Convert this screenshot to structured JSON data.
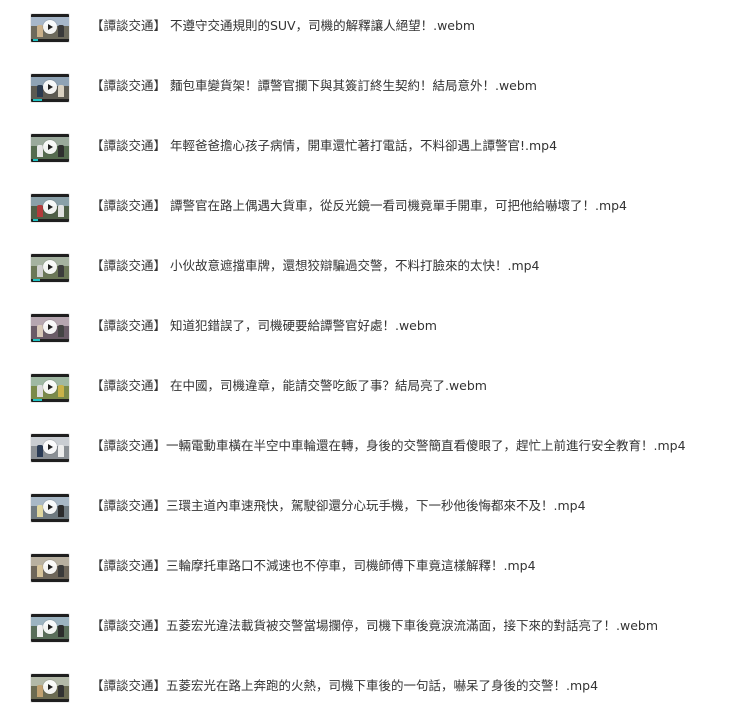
{
  "colors": {
    "text": "#333333",
    "background": "#ffffff",
    "thumbnail_progress": "#20c2c2"
  },
  "file_list": {
    "items": [
      {
        "name": "【譚談交通】 不遵守交通規則的SUV，司機的解釋讓人絕望！.webm",
        "icon": "video-thumbnail-icon",
        "progress": 0.15
      },
      {
        "name": "【譚談交通】 麵包車變貨架！譚警官攔下與其簽訂終生契約！結局意外！.webm",
        "icon": "video-thumbnail-icon",
        "progress": 0.25
      },
      {
        "name": "【譚談交通】 年輕爸爸擔心孩子病情，開車還忙著打電話，不料卻遇上譚警官!.mp4",
        "icon": "video-thumbnail-icon",
        "progress": 0.15
      },
      {
        "name": "【譚談交通】 譚警官在路上偶遇大貨車，從反光鏡一看司機竟單手開車，可把他給嚇壞了！.mp4",
        "icon": "video-thumbnail-icon",
        "progress": 0.15
      },
      {
        "name": "【譚談交通】 小伙故意遮擋車牌，還想狡辯騙過交警，不料打臉來的太快！.mp4",
        "icon": "video-thumbnail-icon",
        "progress": 0.2
      },
      {
        "name": "【譚談交通】 知道犯錯誤了，司機硬要給譚警官好處！.webm",
        "icon": "video-thumbnail-icon",
        "progress": 0.2
      },
      {
        "name": "【譚談交通】 在中國，司機違章，能請交警吃飯了事？結局亮了.webm",
        "icon": "video-thumbnail-icon",
        "progress": 0.25
      },
      {
        "name": "【譚談交通】一輛電動車橫在半空中車輪還在轉，身後的交警簡直看傻眼了，趕忙上前進行安全教育！.mp4",
        "icon": "video-thumbnail-icon",
        "progress": 0.0
      },
      {
        "name": "【譚談交通】三環主道內車速飛快，駕駛卻還分心玩手機，下一秒他後悔都來不及！.mp4",
        "icon": "video-thumbnail-icon",
        "progress": 0.0
      },
      {
        "name": "【譚談交通】三輪摩托車路口不減速也不停車，司機師傅下車竟這樣解釋！.mp4",
        "icon": "video-thumbnail-icon",
        "progress": 0.0
      },
      {
        "name": "【譚談交通】五菱宏光違法載貨被交警當場攔停，司機下車後竟淚流滿面，接下來的對話亮了！.webm",
        "icon": "video-thumbnail-icon",
        "progress": 0.0
      },
      {
        "name": "【譚談交通】五菱宏光在路上奔跑的火熱，司機下車後的一句話，嚇呆了身後的交警！.mp4",
        "icon": "video-thumbnail-icon",
        "progress": 0.0
      }
    ]
  }
}
